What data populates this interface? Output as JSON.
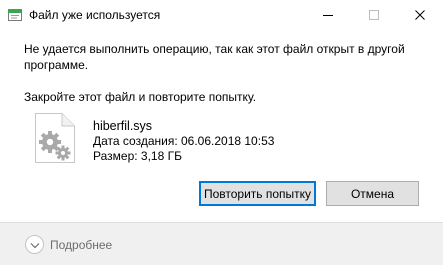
{
  "window": {
    "title": "Файл уже используется",
    "controls": {
      "minimize_icon": "minimize-icon",
      "maximize_icon": "maximize-icon",
      "close_icon": "close-icon"
    }
  },
  "message": {
    "line1": "Не удается выполнить операцию, так как этот файл открыт в другой программе.",
    "line2": "Закройте этот файл и повторите попытку."
  },
  "file": {
    "icon": "system-file-gears-icon",
    "name": "hiberfil.sys",
    "created": "Дата создания: 06.06.2018 10:53",
    "size": "Размер: 3,18 ГБ"
  },
  "buttons": {
    "retry": "Повторить попытку",
    "cancel": "Отмена"
  },
  "footer": {
    "details_label": "Подробнее",
    "details_icon": "chevron-down-icon"
  },
  "colors": {
    "focus_border": "#0078d7",
    "footer_bg": "#f0f0f0",
    "app_icon_green": "#3aa655"
  }
}
